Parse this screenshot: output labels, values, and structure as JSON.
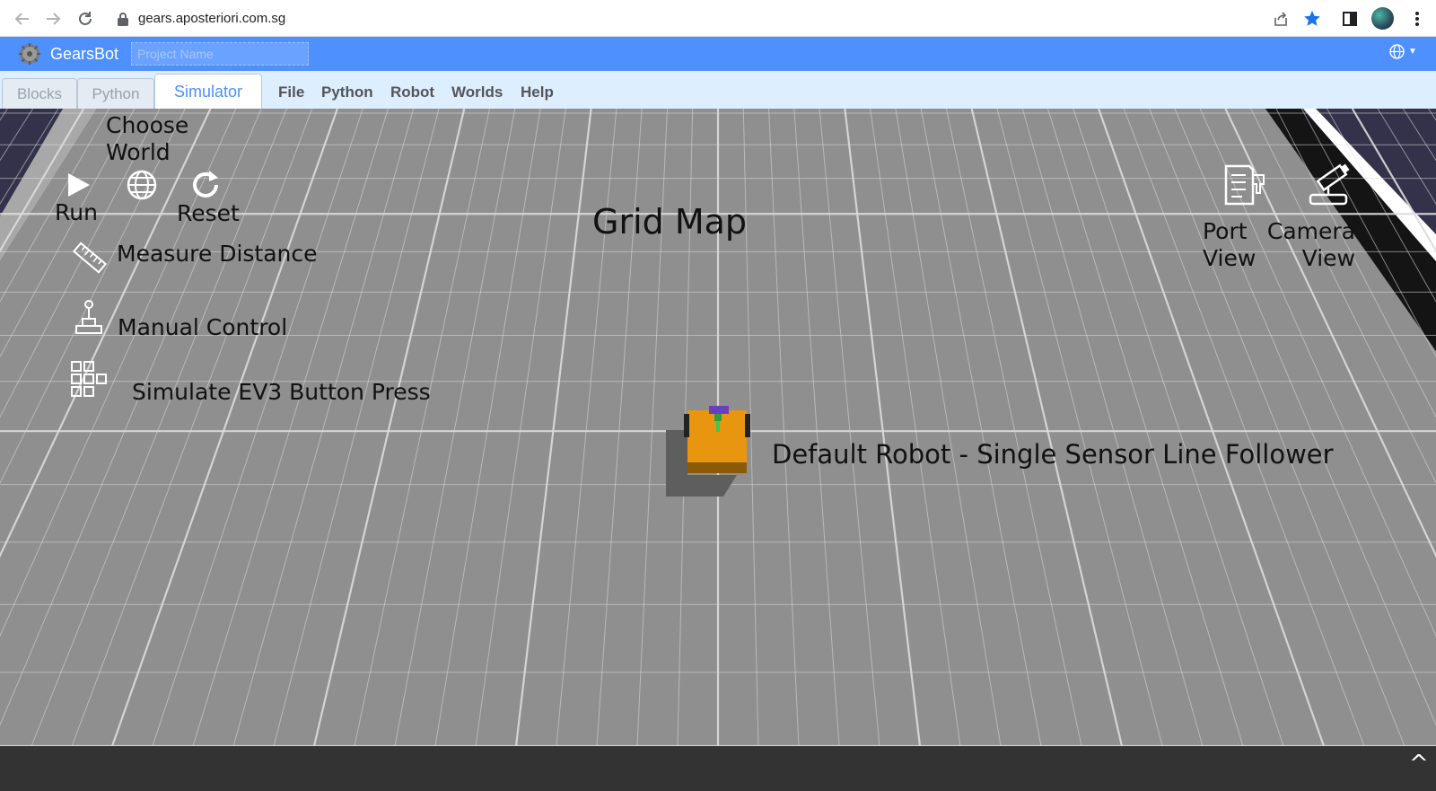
{
  "browser": {
    "url": "gears.aposteriori.com.sg",
    "icons": [
      "back-arrow-icon",
      "forward-arrow-icon",
      "reload-icon",
      "lock-icon",
      "share-icon",
      "bookmark-star-icon",
      "side-panel-icon",
      "avatar",
      "kebab-menu-icon"
    ]
  },
  "header": {
    "app_name": "GearsBot",
    "project_placeholder": "Project Name",
    "language_icon": "globe-icon"
  },
  "tabs": [
    {
      "label": "Blocks",
      "active": false
    },
    {
      "label": "Python",
      "active": false
    },
    {
      "label": "Simulator",
      "active": true
    }
  ],
  "menu": [
    "File",
    "Python",
    "Robot",
    "Worlds",
    "Help"
  ],
  "simulator": {
    "controls": {
      "run_label": "Run",
      "choose_world_label_1": "Choose",
      "choose_world_label_2": "World",
      "reset_label": "Reset",
      "measure_label": "Measure Distance",
      "manual_label": "Manual Control",
      "ev3_label": "Simulate EV3 Button Press",
      "port_view_label_1": "Port",
      "port_view_label_2": "View",
      "camera_view_label_1": "Camera",
      "camera_view_label_2": "View"
    },
    "world_name": "Grid Map",
    "robot_name": "Default Robot - Single Sensor Line Follower",
    "colors": {
      "floor": "#8f8f8f",
      "grid_line": "#dcdcdc",
      "sky": "#33324a",
      "robot_body": "#e8960f",
      "wall_black": "#141414"
    }
  },
  "footer": {
    "toggle_icon": "caret-up-icon"
  }
}
